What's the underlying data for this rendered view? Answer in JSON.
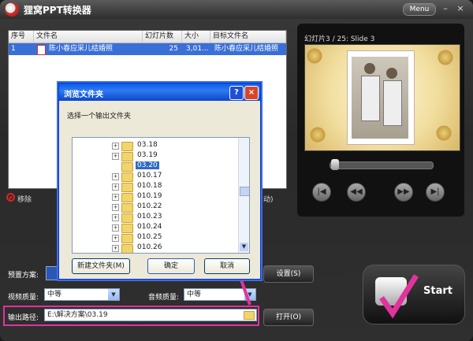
{
  "app": {
    "title": "狸窝PPT转换器",
    "menu_label": "Menu",
    "min_label": "–",
    "close_label": "×"
  },
  "file_list": {
    "columns": [
      "序号",
      "文件名",
      "幻灯片数",
      "大小",
      "目标文件名"
    ],
    "rows": [
      {
        "index": "1",
        "filename": "陈小春应采儿结婚照",
        "slides": "25",
        "size": "3,01...",
        "target": "陈小春应采儿结婚照"
      }
    ]
  },
  "remove_label": "移除",
  "partial_label": "动)",
  "preview": {
    "title": "幻灯片3 / 25: Slide 3"
  },
  "options": {
    "preset_label": "预置方案:",
    "video_quality_label": "视频质量:",
    "video_quality_value": "中等",
    "audio_quality_label": "音频质量:",
    "audio_quality_value": "中等",
    "output_label": "输出路径:",
    "output_value": "E:\\解决方案\\03.19",
    "settings_button": "设置(S)",
    "open_button": "打开(O)",
    "start_button": "Start"
  },
  "dialog": {
    "title": "浏览文件夹",
    "prompt": "选择一个输出文件夹",
    "folders": [
      "03.18",
      "03.19",
      "03.20",
      "010.17",
      "010.18",
      "010.19",
      "010.22",
      "010.23",
      "010.24",
      "010.25",
      "010.26"
    ],
    "selected": "03.20",
    "new_folder_button": "新建文件夹(M)",
    "ok_button": "确定",
    "cancel_button": "取消",
    "help_label": "?",
    "close_label": "×"
  },
  "colors": {
    "accent": "#e0339e",
    "selection": "#316ac5"
  }
}
